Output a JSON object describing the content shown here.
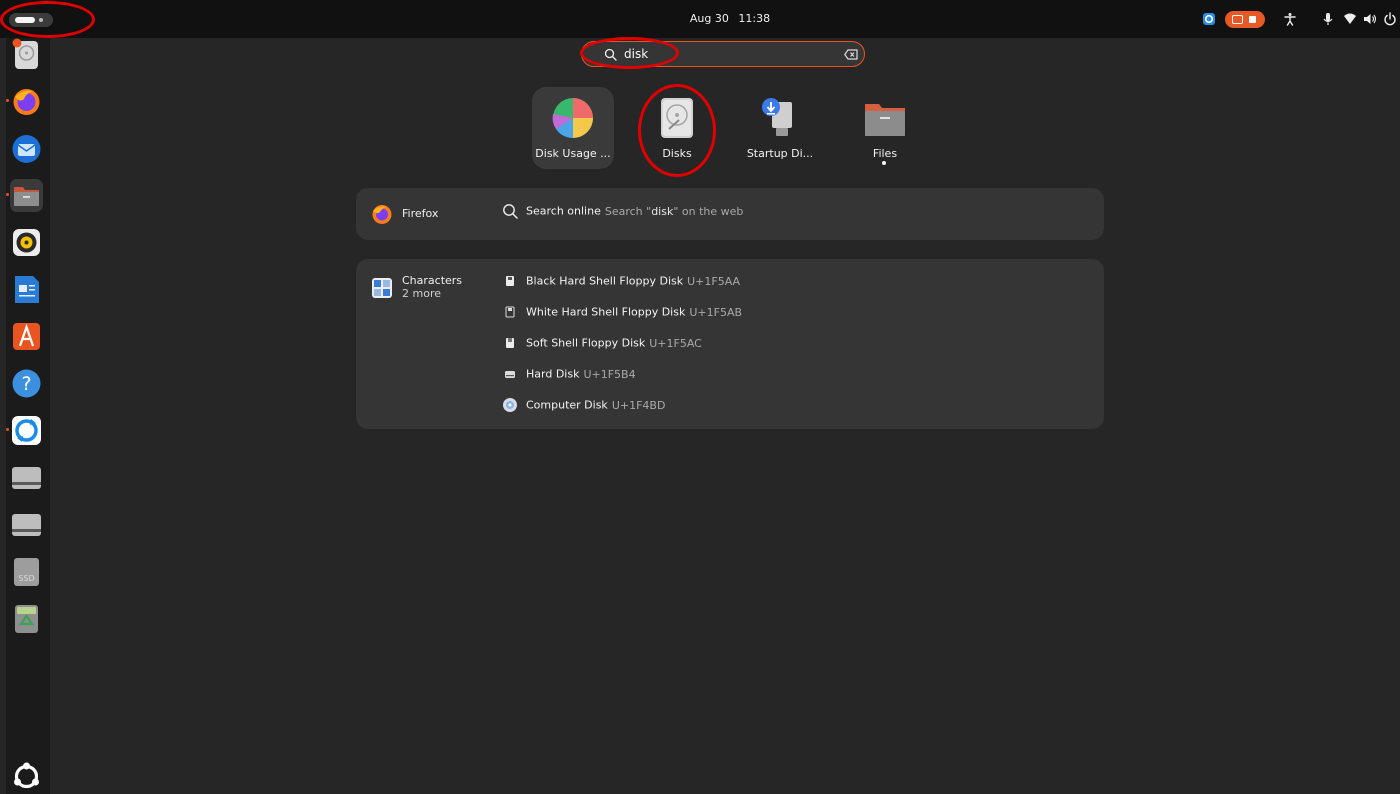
{
  "topbar": {
    "date": "Aug 30",
    "time": "11:38",
    "activities_icon": "activities-pill-icon",
    "tray_icons": [
      "app-indicator-icon",
      "screen-recording-icon",
      "accessibility-icon",
      "microphone-icon",
      "wifi-icon",
      "volume-icon",
      "power-icon"
    ]
  },
  "dock": {
    "items": [
      {
        "name": "disk-usage-analyzer-icon"
      },
      {
        "name": "firefox-icon"
      },
      {
        "name": "thunderbird-icon"
      },
      {
        "name": "files-icon"
      },
      {
        "name": "rhythmbox-icon"
      },
      {
        "name": "libreoffice-writer-icon"
      },
      {
        "name": "app-center-icon"
      },
      {
        "name": "help-icon"
      },
      {
        "name": "remote-desktop-icon"
      },
      {
        "name": "drive-icon"
      },
      {
        "name": "drive-icon"
      },
      {
        "name": "ssd-drive-icon",
        "label": "SSD"
      },
      {
        "name": "trash-icon"
      },
      {
        "name": "show-apps-icon"
      }
    ]
  },
  "search": {
    "value": "disk",
    "icon": "search-icon",
    "clear_icon": "clear-text-icon"
  },
  "apps": [
    {
      "label": "Disk Usage ...",
      "icon": "disk-usage-pie-icon"
    },
    {
      "label": "Disks",
      "icon": "disks-icon"
    },
    {
      "label": "Startup Di...",
      "icon": "startup-disk-creator-icon"
    },
    {
      "label": "Files",
      "icon": "files-folder-icon"
    }
  ],
  "firefox_provider": {
    "name": "Firefox",
    "result_title": "Search online",
    "result_desc_prefix": "Search \"",
    "result_desc_term": "disk",
    "result_desc_suffix": "\" on the web"
  },
  "characters_provider": {
    "name": "Characters",
    "more": "2 more",
    "results": [
      {
        "title": "Black Hard Shell Floppy Disk",
        "code": "U+1F5AA"
      },
      {
        "title": "White Hard Shell Floppy Disk",
        "code": "U+1F5AB"
      },
      {
        "title": "Soft Shell Floppy Disk",
        "code": "U+1F5AC"
      },
      {
        "title": "Hard Disk",
        "code": "U+1F5B4"
      },
      {
        "title": "Computer Disk",
        "code": "U+1F4BD"
      }
    ]
  },
  "colors": {
    "accent": "#e95420",
    "annotation": "#e00000",
    "panel": "#353535",
    "background": "#262626"
  }
}
